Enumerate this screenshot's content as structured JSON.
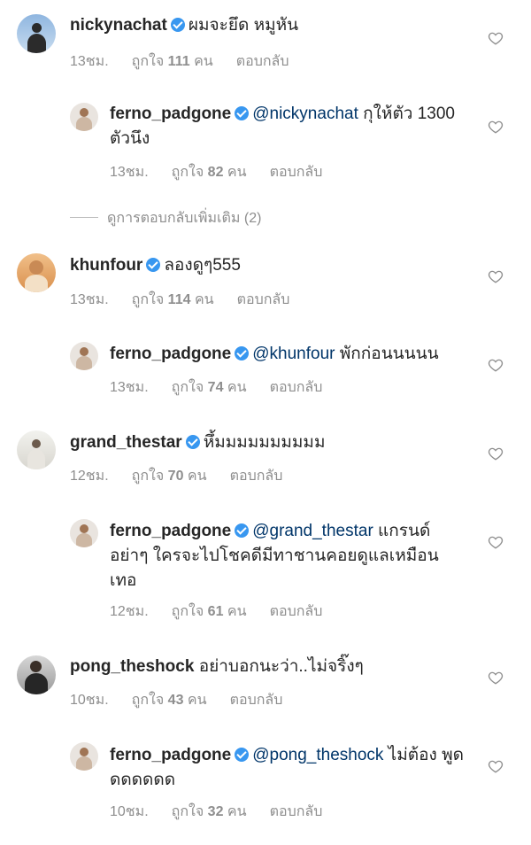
{
  "heart_color": "#8e8e8e",
  "verified_color": "#3897f0",
  "like_prefix": "ถูกใจ",
  "like_suffix": "คน",
  "reply_label": "ตอบกลับ",
  "view_more_replies": "ดูการตอบกลับเพิ่มเติม (2)",
  "comments": [
    {
      "username": "nickynachat",
      "mention": "",
      "text": "ผมจะยึด หมูหัน",
      "time": "13ชม.",
      "likes": "111"
    },
    {
      "username": "ferno_padgone",
      "mention": "@nickynachat",
      "text": " กุให้ตัว 1300 ตัวนึง",
      "time": "13ชม.",
      "likes": "82"
    },
    {
      "username": "khunfour",
      "mention": "",
      "text": "ลองดูๆ555",
      "time": "13ชม.",
      "likes": "114"
    },
    {
      "username": "ferno_padgone",
      "mention": "@khunfour",
      "text": " พักก่อนนนนน",
      "time": "13ชม.",
      "likes": "74"
    },
    {
      "username": "grand_thestar",
      "mention": "",
      "text": "หึ้มมมมมมมมมม",
      "time": "12ชม.",
      "likes": "70"
    },
    {
      "username": "ferno_padgone",
      "mention": "@grand_thestar",
      "text": " แกรนด์ อย่าๆ ใครจะไปโชคดีมีทาชานคอยดูแลเหมือน เทอ",
      "time": "12ชม.",
      "likes": "61"
    },
    {
      "username": "pong_theshock",
      "mention": "",
      "text": "อย่าบอกนะว่า..ไม่จริ๊งๆ",
      "time": "10ชม.",
      "likes": "43"
    },
    {
      "username": "ferno_padgone",
      "mention": "@pong_theshock",
      "text": " ไม่ต้อง พูดดดดดดด",
      "time": "10ชม.",
      "likes": "32"
    }
  ]
}
